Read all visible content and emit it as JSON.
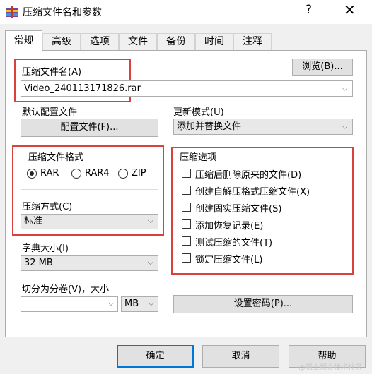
{
  "window": {
    "title": "压缩文件名和参数",
    "help_glyph": "?",
    "close_glyph": "✕"
  },
  "tabs": [
    {
      "label": "常规",
      "active": true
    },
    {
      "label": "高级"
    },
    {
      "label": "选项"
    },
    {
      "label": "文件"
    },
    {
      "label": "备份"
    },
    {
      "label": "时间"
    },
    {
      "label": "注释"
    }
  ],
  "archive_name": {
    "label": "压缩文件名(A)",
    "value": "Video_240113171826.rar",
    "browse_label": "浏览(B)..."
  },
  "profile": {
    "label": "默认配置文件",
    "button_label": "配置文件(F)..."
  },
  "update_mode": {
    "label": "更新模式(U)",
    "value": "添加并替换文件"
  },
  "format": {
    "label": "压缩文件格式",
    "options": [
      "RAR",
      "RAR4",
      "ZIP"
    ],
    "selected": "RAR"
  },
  "method": {
    "label": "压缩方式(C)",
    "value": "标准"
  },
  "dictionary": {
    "label": "字典大小(I)",
    "value": "32 MB"
  },
  "split": {
    "label": "切分为分卷(V)，大小",
    "value": "",
    "unit": "MB"
  },
  "options_group": {
    "label": "压缩选项",
    "items": [
      {
        "label": "压缩后删除原来的文件(D)",
        "checked": false
      },
      {
        "label": "创建自解压格式压缩文件(X)",
        "checked": false
      },
      {
        "label": "创建固实压缩文件(S)",
        "checked": false
      },
      {
        "label": "添加恢复记录(E)",
        "checked": false
      },
      {
        "label": "测试压缩的文件(T)",
        "checked": false
      },
      {
        "label": "锁定压缩文件(L)",
        "checked": false
      }
    ]
  },
  "password_button": "设置密码(P)...",
  "footer": {
    "ok": "确定",
    "cancel": "取消",
    "help": "帮助"
  },
  "watermark": "@稀土掘金技术社区",
  "colors": {
    "highlight_box": "#d9413f",
    "focus_border": "#0078d7"
  },
  "icons": {
    "app": "winrar-icon",
    "dropdown": "chevron-down-icon"
  }
}
